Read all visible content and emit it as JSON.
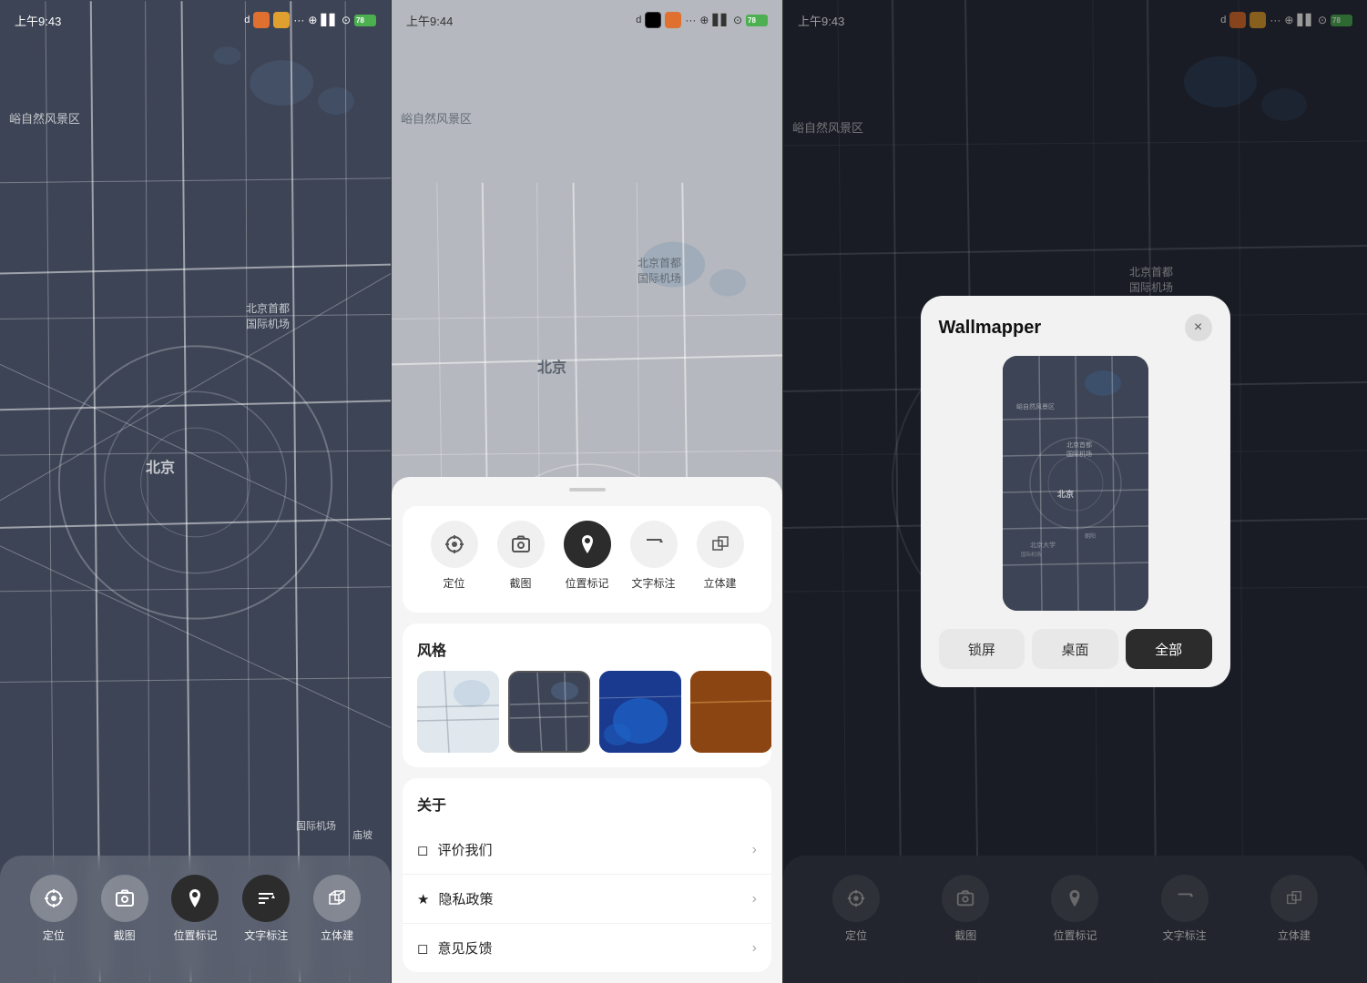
{
  "screen1": {
    "status": {
      "time": "上午9:43",
      "bluetooth": "⊕",
      "signal": "▲▲▲",
      "wifi": "⊙",
      "battery": "78"
    },
    "map": {
      "label_airport": "北京首都\n国际机场",
      "label_beijing": "北京",
      "label_scenic": "峪自然风景区",
      "label_bottom": "庙坡"
    },
    "toolbar": {
      "items": [
        {
          "id": "locate",
          "label": "定位",
          "icon": "⊕"
        },
        {
          "id": "screenshot",
          "label": "截图",
          "icon": "📷"
        },
        {
          "id": "marker",
          "label": "位置标记",
          "icon": "📍"
        },
        {
          "id": "text",
          "label": "文字标注",
          "icon": "🚩"
        },
        {
          "id": "3d",
          "label": "立体建",
          "icon": "🏢"
        }
      ]
    }
  },
  "screen2": {
    "status": {
      "time": "上午9:44",
      "battery": "78"
    },
    "sheet": {
      "toolbar_items": [
        {
          "id": "locate",
          "label": "定位",
          "icon": "⊕",
          "active": false
        },
        {
          "id": "screenshot",
          "label": "截图",
          "icon": "📷",
          "active": false
        },
        {
          "id": "marker",
          "label": "位置标记",
          "icon": "📍",
          "active": true
        },
        {
          "id": "text",
          "label": "文字标注",
          "icon": "🚩",
          "active": false
        },
        {
          "id": "3d",
          "label": "立体建",
          "icon": "🏢",
          "active": false
        }
      ],
      "style_section": {
        "title": "风格",
        "styles": [
          "light",
          "dark",
          "blue",
          "brown"
        ]
      },
      "about_section": {
        "title": "关于",
        "items": [
          {
            "icon": "◻",
            "label": "评价我们"
          },
          {
            "icon": "★",
            "label": "隐私政策"
          },
          {
            "icon": "◻",
            "label": "意见反馈"
          }
        ]
      }
    }
  },
  "screen3": {
    "status": {
      "time": "上午9:43",
      "battery": "78"
    },
    "dialog": {
      "title": "Wallmapper",
      "close_label": "×",
      "buttons": [
        {
          "id": "lock",
          "label": "锁屏"
        },
        {
          "id": "desktop",
          "label": "桌面"
        },
        {
          "id": "all",
          "label": "全部"
        }
      ]
    },
    "toolbar": {
      "items": [
        {
          "id": "locate",
          "label": "定位",
          "icon": "⊕"
        },
        {
          "id": "screenshot",
          "label": "截图",
          "icon": "📷"
        },
        {
          "id": "marker",
          "label": "位置标记",
          "icon": "📍"
        },
        {
          "id": "text",
          "label": "文字标注",
          "icon": "🚩"
        },
        {
          "id": "3d",
          "label": "立体建",
          "icon": "🏢"
        }
      ]
    }
  }
}
